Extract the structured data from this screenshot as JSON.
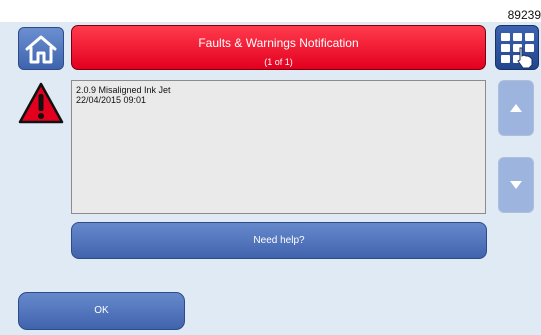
{
  "document_number": "89239",
  "header": {
    "title": "Faults & Warnings Notification",
    "subtitle": "(1 of 1)"
  },
  "message": {
    "lines": [
      "2.0.9 Misaligned Ink Jet",
      "22/04/2015 09:01"
    ]
  },
  "buttons": {
    "help_label": "Need help?",
    "ok_label": "OK"
  },
  "icons": {
    "home": "home-icon",
    "menu": "grid-menu-hand-icon",
    "warning": "warning-triangle-icon",
    "scroll_up": "arrow-up-icon",
    "scroll_down": "arrow-down-icon"
  },
  "colors": {
    "banner_red": "#e3001f",
    "button_blue": "#4063ad",
    "scroll_blue": "#9cb4de",
    "background": "#dfeaf5"
  }
}
